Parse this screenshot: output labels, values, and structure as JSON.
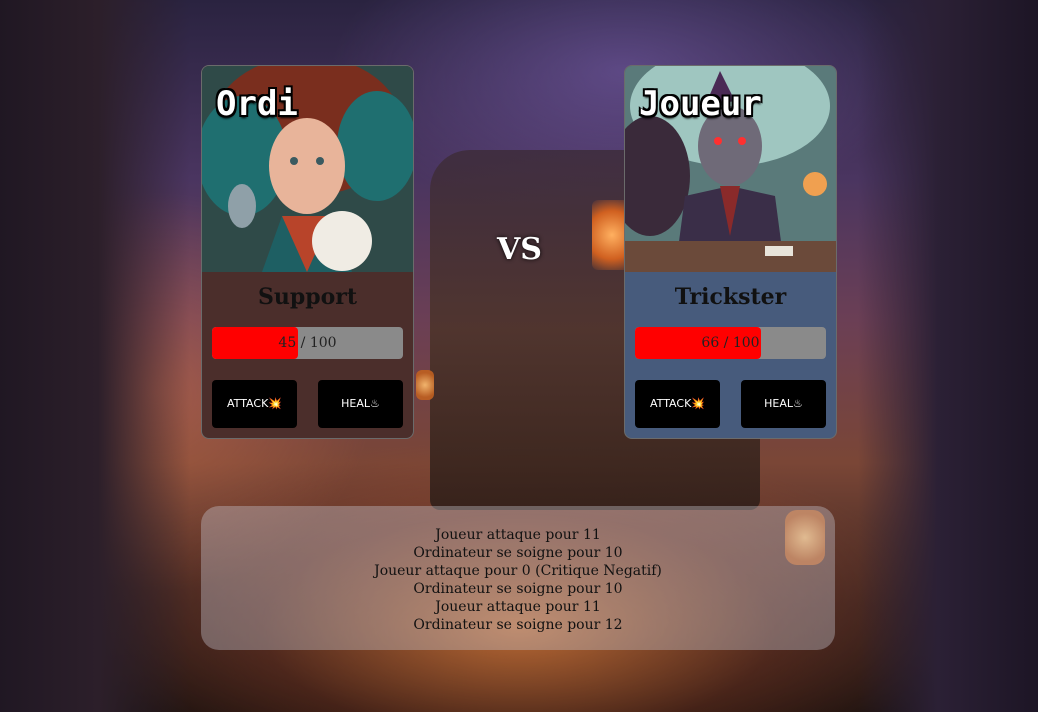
{
  "vs_label": "VS",
  "players": [
    {
      "name": "Ordi",
      "role": "Support",
      "hp": 45,
      "hp_max": 100,
      "hp_text": "45 / 100",
      "card_color": "#4b2e2b",
      "portrait": "red-haired-woman-with-bird-portrait",
      "attack_label": "ATTACK💥",
      "heal_label": "HEAL♨"
    },
    {
      "name": "Joueur",
      "role": "Trickster",
      "hp": 66,
      "hp_max": 100,
      "hp_text": "66 / 100",
      "card_color": "#475b7c",
      "portrait": "goblin-card-player-portrait",
      "attack_label": "ATTACK💥",
      "heal_label": "HEAL♨"
    }
  ],
  "hp_color": "#ff0000",
  "log": [
    "Joueur attaque pour 11",
    "Ordinateur se soigne pour 10",
    "Joueur attaque pour 0 (Critique Negatif)",
    "Ordinateur se soigne pour 10",
    "Joueur attaque pour 11",
    "Ordinateur se soigne pour 12"
  ]
}
